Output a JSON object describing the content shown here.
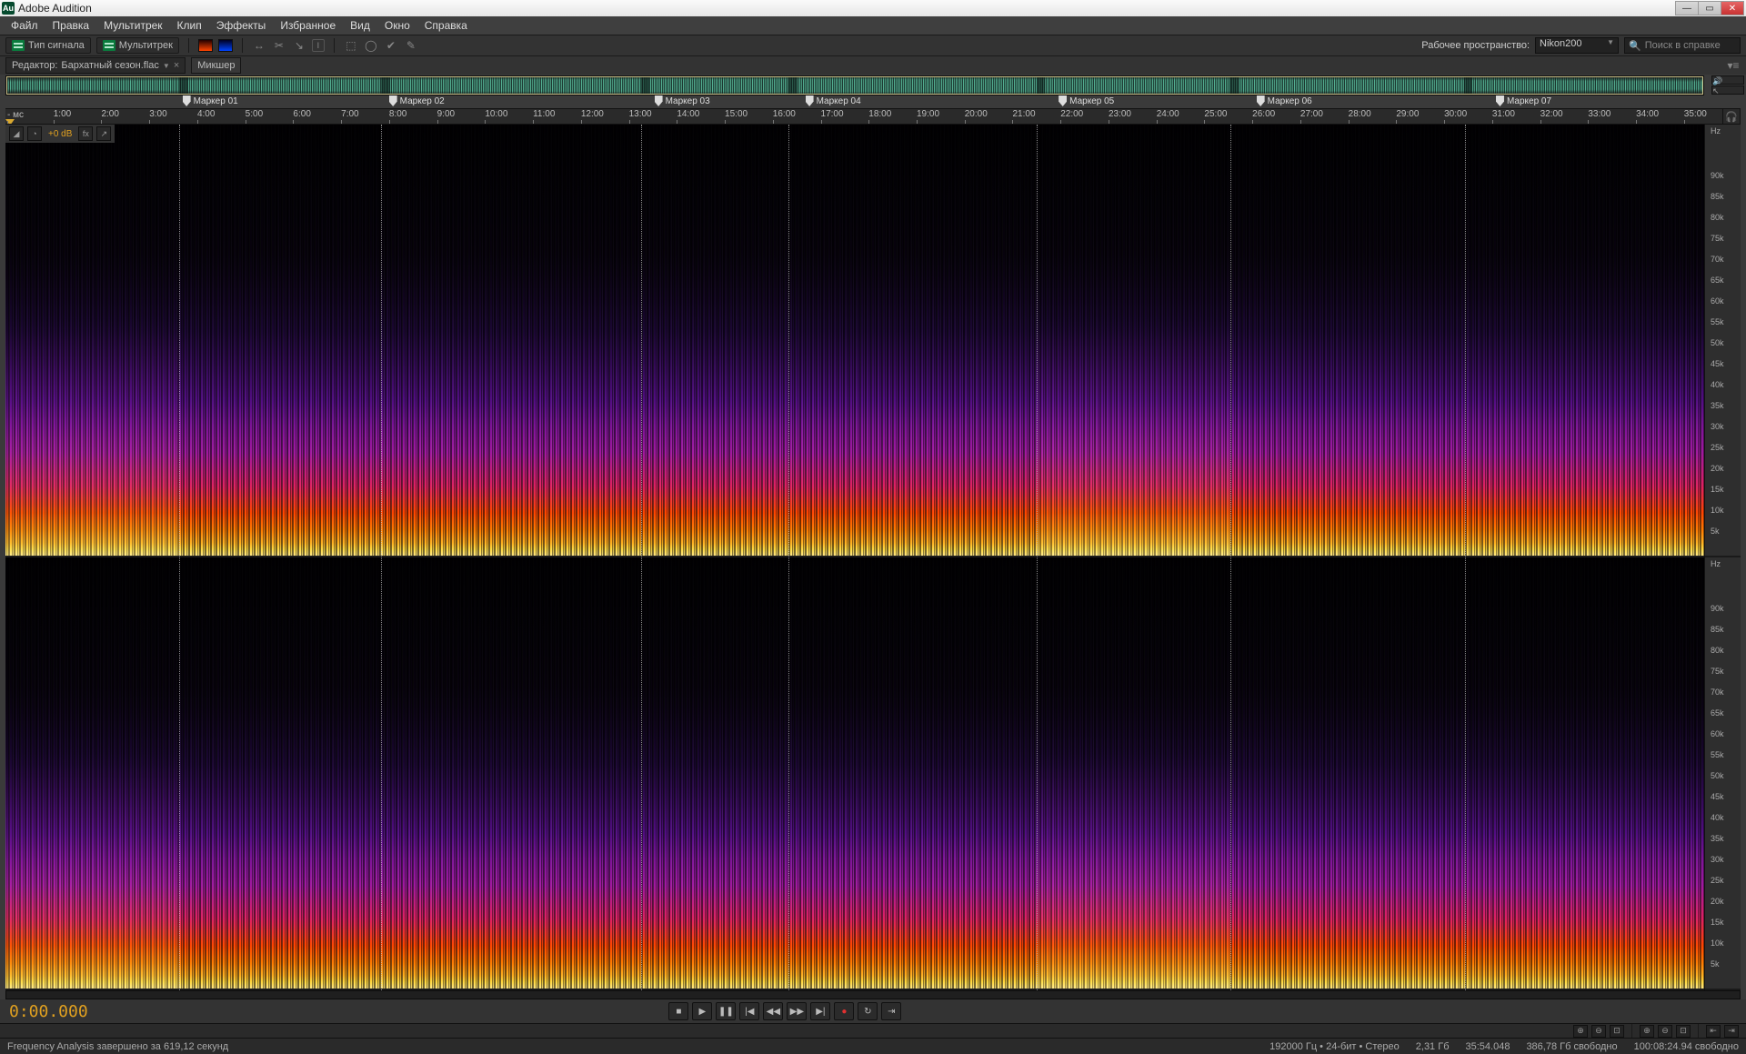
{
  "titlebar": {
    "app_name": "Adobe Audition",
    "app_badge": "Au"
  },
  "menu": [
    "Файл",
    "Правка",
    "Мультитрек",
    "Клип",
    "Эффекты",
    "Избранное",
    "Вид",
    "Окно",
    "Справка"
  ],
  "views": {
    "waveform": "Тип сигнала",
    "multitrack": "Мультитрек"
  },
  "workspace": {
    "label": "Рабочее пространство:",
    "value": "Nikon200"
  },
  "search": {
    "placeholder": "Поиск в справке"
  },
  "tabs": {
    "editor_prefix": "Редактор:",
    "filename": "Бархатный сезон.flac",
    "mixer": "Микшер"
  },
  "db_readout": "+0 dB",
  "markers": [
    {
      "label": "Маркер 01",
      "pct": 10.2
    },
    {
      "label": "Маркер 02",
      "pct": 22.1
    },
    {
      "label": "Маркер 03",
      "pct": 37.4
    },
    {
      "label": "Маркер 04",
      "pct": 46.1
    },
    {
      "label": "Маркер 05",
      "pct": 60.7
    },
    {
      "label": "Маркер 06",
      "pct": 72.1
    },
    {
      "label": "Маркер 07",
      "pct": 85.9
    }
  ],
  "time_ruler": {
    "start": "- мс",
    "ticks": [
      "1:00",
      "2:00",
      "3:00",
      "4:00",
      "5:00",
      "6:00",
      "7:00",
      "8:00",
      "9:00",
      "10:00",
      "11:00",
      "12:00",
      "13:00",
      "14:00",
      "15:00",
      "16:00",
      "17:00",
      "18:00",
      "19:00",
      "20:00",
      "21:00",
      "22:00",
      "23:00",
      "24:00",
      "25:00",
      "26:00",
      "27:00",
      "28:00",
      "29:00",
      "30:00",
      "31:00",
      "32:00",
      "33:00",
      "34:00",
      "35:00"
    ]
  },
  "freq_unit": "Hz",
  "freq_labels": [
    "90k",
    "85k",
    "80k",
    "75k",
    "70k",
    "65k",
    "60k",
    "55k",
    "50k",
    "45k",
    "40k",
    "35k",
    "30k",
    "25k",
    "20k",
    "15k",
    "10k",
    "5k"
  ],
  "timecode": "0:00.000",
  "status": {
    "left": "Frequency Analysis завершено за 619,12 секунд",
    "sample_info": "192000 Гц • 24-бит • Стерео",
    "file_size": "2,31 Гб",
    "duration": "35:54.048",
    "disk_free": "386,78 Гб свободно",
    "time_free": "100:08:24.94 свободно"
  },
  "icons": {
    "search": "🔍",
    "headphones": "🎧",
    "min": "—",
    "max": "▭",
    "close": "✕",
    "stop": "■",
    "play": "▶",
    "pause": "❚❚",
    "start": "|◀",
    "rew": "◀◀",
    "fwd": "▶▶",
    "end": "▶|",
    "rec": "●",
    "loop": "↻",
    "skip": "⇥"
  },
  "segments_brighter": [
    {
      "left_pct": 0.0,
      "width_pct": 10.2
    },
    {
      "left_pct": 60.7,
      "width_pct": 11.4
    }
  ]
}
